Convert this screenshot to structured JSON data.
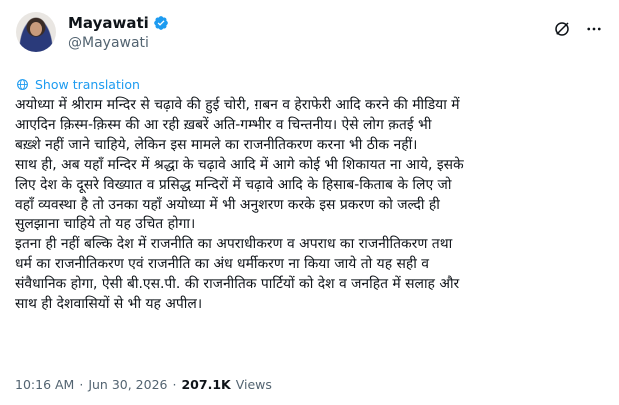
{
  "post": {
    "author": {
      "display_name": "Mayawati",
      "handle": "@Mayawati",
      "verified": true
    },
    "translate_label": "Show translation",
    "body": "अयोध्या में श्रीराम मन्दिर से चढ़ावे की हुई चोरी, ग़बन व हेराफेरी आदि करने की मीडिया में\nआएदिन क़िस्म-क़िस्म की आ रही ख़बरें अति-गम्भीर व चिन्तनीय। ऐसे लोग क़तई भी\nबख़्शे नहीं जाने चाहिये, लेकिन इस मामले का राजनीतिकरण करना भी ठीक नहीं।\nसाथ ही, अब यहाँ मन्दिर में श्रद्धा के चढ़ावे आदि में आगे कोई भी शिकायत ना आये, इसके\nलिए देश के दूसरे विख्यात व प्रसिद्ध मन्दिरों में चढ़ावे आदि के हिसाब-किताब के लिए जो\nवहाँ व्यवस्था है तो उनका यहाँ अयोध्या में भी अनुशरण करके इस प्रकरण को जल्दी ही\nसुलझाना चाहिये तो यह उचित होगा।\nइतना ही नहीं बल्कि देश में राजनीति का अपराधीकरण व अपराध का राजनीतिकरण तथा\nधर्म का राजनीतिकरण एवं राजनीति का अंध धर्मीकरण ना किया जाये तो यह सही व\nसंवैधानिक होगा, ऐसी बी.एस.पी. की राजनीतिक पार्टियों को देश व जनहित में सलाह और\nसाथ ही देशवासियों से भी यह अपील।",
    "meta": {
      "time": "10:16 AM",
      "separator": "·",
      "date": "Jun 30, 2026",
      "views_count": "207.1K",
      "views_label": "Views"
    }
  },
  "icons": {
    "verified": "verified-badge-icon",
    "grok": "grok-icon",
    "more": "more-icon",
    "translate": "globe-icon"
  },
  "colors": {
    "accent": "#1d9bf0",
    "muted": "#536471",
    "text": "#0f1419"
  }
}
